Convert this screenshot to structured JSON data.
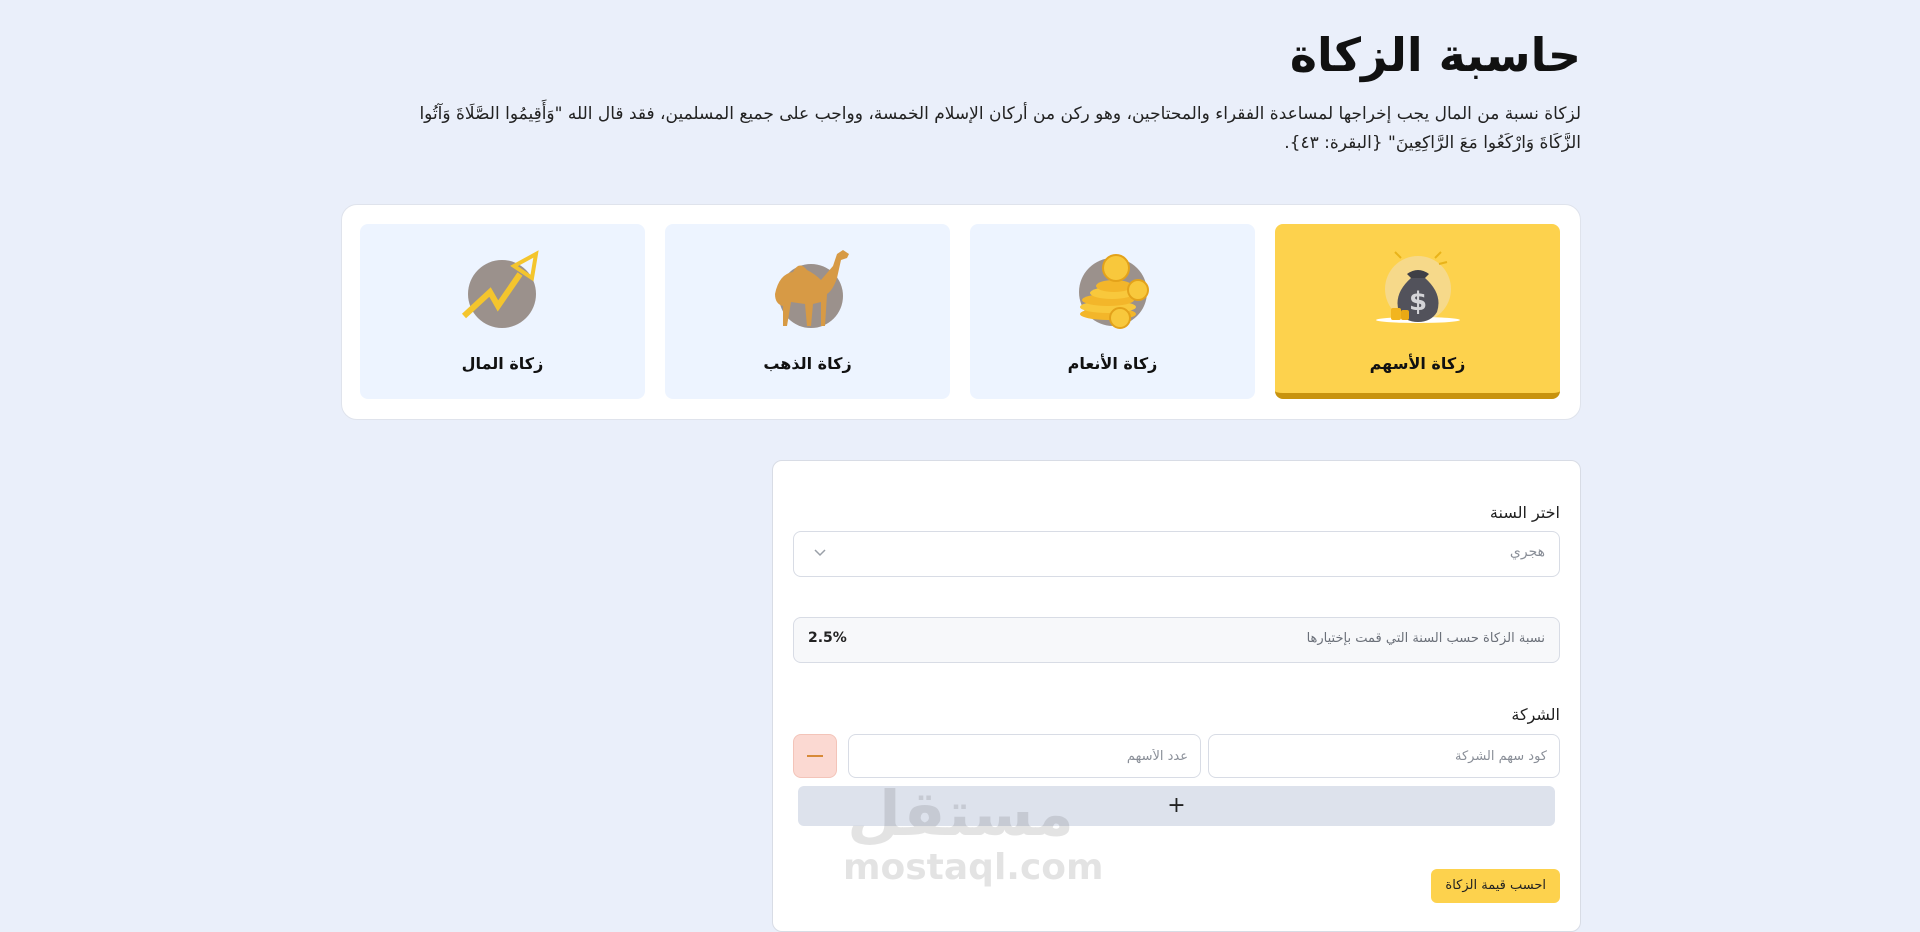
{
  "page": {
    "title": "حاسبة الزكاة",
    "intro": "لزكاة نسبة من المال يجب إخراجها لمساعدة الفقراء والمحتاجين، وهو ركن من أركان الإسلام الخمسة، وواجب على جميع المسلمين، فقد قال الله \"وَأَقِيمُوا الصَّلَاةَ وَآتُوا الزَّكَاةَ وَارْكَعُوا مَعَ الرَّاكِعِينَ\" {البقرة: ٤٣}."
  },
  "tabs": [
    {
      "label": "زكاة الأسهم",
      "icon": "money-bag-icon",
      "active": true
    },
    {
      "label": "زكاة الأنعام",
      "icon": "gold-coins-icon",
      "active": false
    },
    {
      "label": "زكاة الذهب",
      "icon": "camel-icon",
      "active": false
    },
    {
      "label": "زكاة المال",
      "icon": "trend-arrow-icon",
      "active": false
    }
  ],
  "form": {
    "year_label": "اختر السنة",
    "year_value": "هجري",
    "rate_label": "نسبة الزكاة حسب السنة التي قمت بإختيارها",
    "rate_value": "2.5%",
    "company_label": "الشركة",
    "company_code_placeholder": "كود سهم الشركة",
    "shares_count_placeholder": "عدد الأسهم",
    "add_row": "+",
    "calculate_button": "احسب قيمة الزكاة"
  },
  "watermark": {
    "arabic": "مستقل",
    "latin": "mostaql.com"
  },
  "colors": {
    "background": "#eaeffa",
    "accent_yellow": "#fdd24d",
    "active_underline": "#c8930e",
    "tab_background": "#edf4ff",
    "remove_button": "#fbd9d2"
  }
}
